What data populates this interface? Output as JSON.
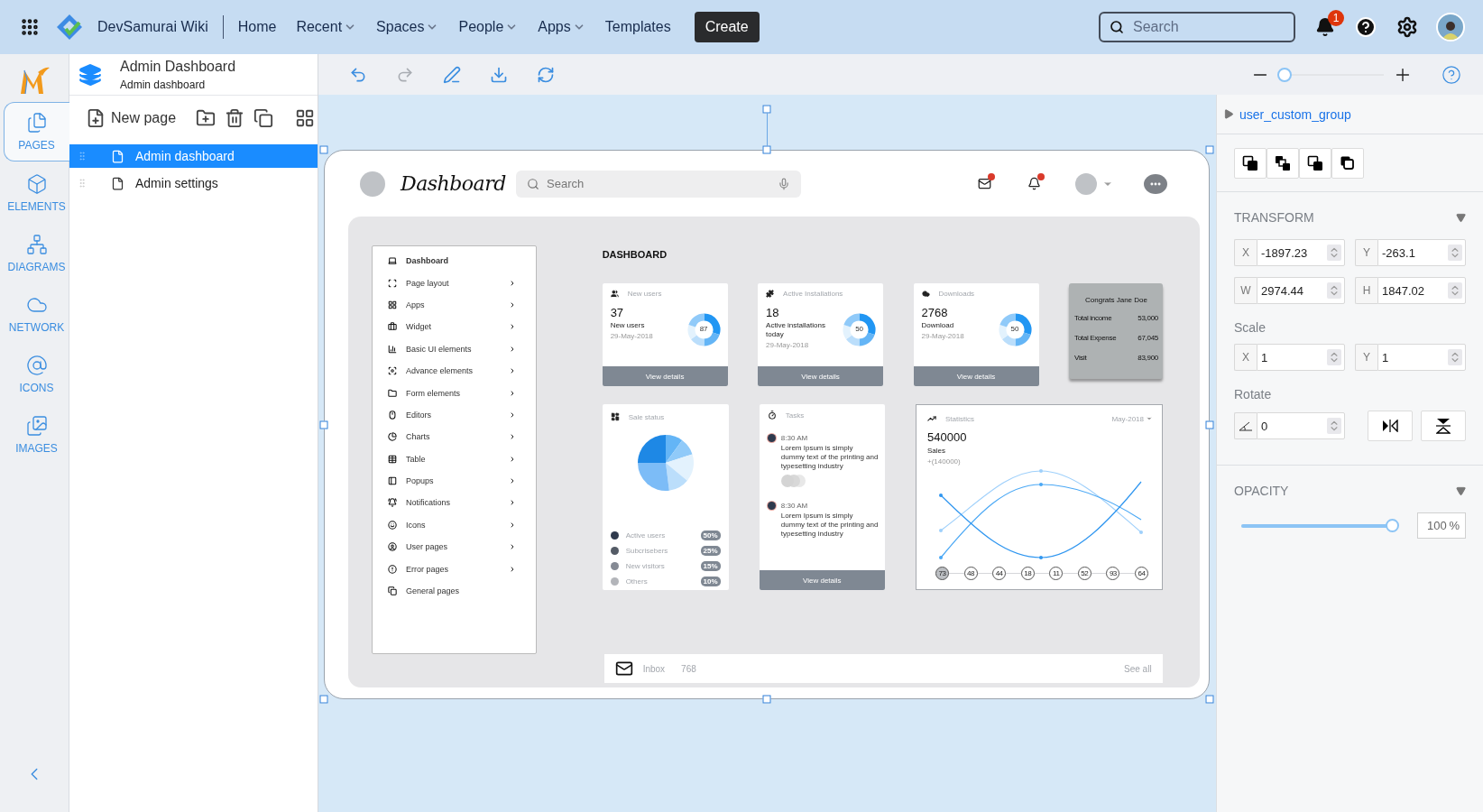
{
  "topbar": {
    "brand": "DevSamurai Wiki",
    "nav": [
      {
        "label": "Home",
        "dropdown": false
      },
      {
        "label": "Recent",
        "dropdown": true
      },
      {
        "label": "Spaces",
        "dropdown": true
      },
      {
        "label": "People",
        "dropdown": true
      },
      {
        "label": "Apps",
        "dropdown": true
      },
      {
        "label": "Templates",
        "dropdown": false
      }
    ],
    "create": "Create",
    "search": {
      "placeholder": "Search"
    },
    "notifications": "1"
  },
  "rail": [
    {
      "label": "PAGES",
      "kind": "pages",
      "selected": true
    },
    {
      "label": "ELEMENTS",
      "kind": "elements",
      "selected": false
    },
    {
      "label": "DIAGRAMS",
      "kind": "diagrams",
      "selected": false
    },
    {
      "label": "NETWORK",
      "kind": "network",
      "selected": false
    },
    {
      "label": "ICONS",
      "kind": "icons",
      "selected": false
    },
    {
      "label": "IMAGES",
      "kind": "images",
      "selected": false
    }
  ],
  "pages_panel": {
    "title": "Admin Dashboard",
    "subtitle": "Admin dashboard",
    "new_page": "New page",
    "pages": [
      {
        "label": "Admin dashboard",
        "selected": true
      },
      {
        "label": "Admin settings",
        "selected": false
      }
    ]
  },
  "toolbar": {
    "tools": [
      {
        "kind": "undo",
        "disabled": false
      },
      {
        "kind": "redo",
        "disabled": true
      },
      {
        "kind": "edit",
        "disabled": false
      },
      {
        "kind": "download",
        "disabled": false
      },
      {
        "kind": "refresh",
        "disabled": false
      }
    ],
    "zoom": {
      "level": 0.05
    }
  },
  "artboard": {
    "title": "Dashboard",
    "search": {
      "placeholder": "Search"
    },
    "menu": [
      {
        "label": "Dashboard",
        "kind": "laptop",
        "submenu": false,
        "selected": true
      },
      {
        "label": "Page layout",
        "kind": "layout",
        "submenu": true,
        "selected": false
      },
      {
        "label": "Apps",
        "kind": "apps",
        "submenu": true,
        "selected": false
      },
      {
        "label": "Widget",
        "kind": "widget",
        "submenu": true,
        "selected": false
      },
      {
        "label": "Basic UI elements",
        "kind": "basic",
        "submenu": true,
        "selected": false
      },
      {
        "label": "Advance elements",
        "kind": "advance",
        "submenu": true,
        "selected": false
      },
      {
        "label": "Form elements",
        "kind": "form",
        "submenu": true,
        "selected": false
      },
      {
        "label": "Editors",
        "kind": "editors",
        "submenu": true,
        "selected": false
      },
      {
        "label": "Charts",
        "kind": "charts",
        "submenu": true,
        "selected": false
      },
      {
        "label": "Table",
        "kind": "table",
        "submenu": true,
        "selected": false
      },
      {
        "label": "Popups",
        "kind": "popups",
        "submenu": true,
        "selected": false
      },
      {
        "label": "Notifications",
        "kind": "notifications",
        "submenu": true,
        "selected": false
      },
      {
        "label": "Icons",
        "kind": "icons",
        "submenu": true,
        "selected": false
      },
      {
        "label": "User pages",
        "kind": "user",
        "submenu": true,
        "selected": false
      },
      {
        "label": "Error pages",
        "kind": "error",
        "submenu": true,
        "selected": false
      },
      {
        "label": "General pages",
        "kind": "general",
        "submenu": false,
        "selected": false
      }
    ],
    "heading": "DASHBOARD",
    "stat_cards": [
      {
        "kind": "users",
        "title": "New users",
        "value": "37",
        "caption": "New users",
        "date": "29-May-2018",
        "donut": "87",
        "button": "View details"
      },
      {
        "kind": "puzzle",
        "title": "Active Installations",
        "value": "18",
        "caption": "Active installations today",
        "date": "29-May-2018",
        "donut": "50",
        "button": "View details"
      },
      {
        "kind": "cloud",
        "title": "Downloads",
        "value": "2768",
        "caption": "Download",
        "date": "29-May-2018",
        "donut": "50",
        "button": "View details"
      }
    ],
    "summary": {
      "title": "Congrats Jane Doe",
      "rows": [
        {
          "label": "Total income",
          "value": "53,000"
        },
        {
          "label": "Total Expense",
          "value": "67,045"
        },
        {
          "label": "Visit",
          "value": "83,900"
        }
      ]
    },
    "sale_status": {
      "title": "Sale status",
      "legend": [
        {
          "label": "Active users",
          "percent": "50%",
          "color": "#2f3a4d"
        },
        {
          "label": "Subcrisebers",
          "percent": "25%",
          "color": "#545b66"
        },
        {
          "label": "New visitors",
          "percent": "15%",
          "color": "#858a94"
        },
        {
          "label": "Others",
          "percent": "10%",
          "color": "#b3b5ba"
        }
      ]
    },
    "tasks": {
      "title": "Tasks",
      "button": "View details",
      "items": [
        {
          "kind": "toggle",
          "time": "8:30 AM",
          "text": "Lorem Ipsum is simply dummy text of the printing and typesetting industry"
        },
        {
          "kind": "plain",
          "time": "8:30 AM",
          "text": "Lorem Ipsum is simply dummy text of the printing and typesetting industry"
        }
      ]
    },
    "statistics": {
      "title": "Statistics",
      "period": "May-2018",
      "value": "540000",
      "caption": "Sales",
      "delta": "+(140000)",
      "points": [
        {
          "label": "73",
          "selected": true
        },
        {
          "label": "48",
          "selected": false
        },
        {
          "label": "44",
          "selected": false
        },
        {
          "label": "18",
          "selected": false
        },
        {
          "label": "11",
          "selected": false
        },
        {
          "label": "52",
          "selected": false
        },
        {
          "label": "93",
          "selected": false
        },
        {
          "label": "64",
          "selected": false
        }
      ]
    },
    "inbox": {
      "label": "Inbox",
      "count": "768",
      "link": "See all"
    }
  },
  "properties": {
    "group": "user_custom_group",
    "transform": {
      "title": "TRANSFORM",
      "fields": [
        {
          "label": "X",
          "value": "-1897.23"
        },
        {
          "label": "Y",
          "value": "-263.1"
        },
        {
          "label": "W",
          "value": "2974.44"
        },
        {
          "label": "H",
          "value": "1847.02"
        }
      ]
    },
    "scale": {
      "title": "Scale",
      "fields": [
        {
          "label": "X",
          "value": "1"
        },
        {
          "label": "Y",
          "value": "1"
        }
      ]
    },
    "rotate": {
      "title": "Rotate",
      "value": "0"
    },
    "opacity": {
      "title": "OPACITY",
      "level": 1,
      "value": "100",
      "unit": "%"
    }
  }
}
